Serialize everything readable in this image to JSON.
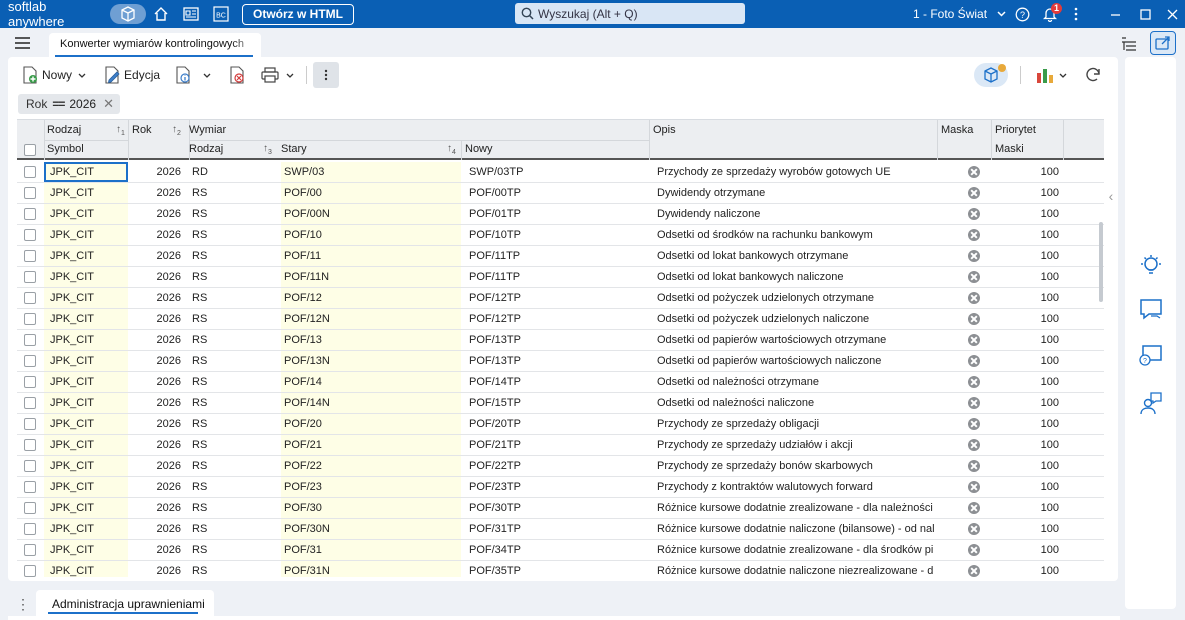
{
  "titlebar": {
    "app_name": "softlab anywhere",
    "open_html_label": "Otwórz w HTML",
    "search_placeholder": "Wyszukaj (Alt + Q)",
    "company": "1 - Foto Świat",
    "notification_count": "1",
    "bc_label": "BC"
  },
  "tabs": {
    "active_doc": "Konwerter wymiarów kontrolingowych"
  },
  "toolbar": {
    "new_label": "Nowy",
    "edit_label": "Edycja"
  },
  "filter": {
    "field": "Rok",
    "operator": "==",
    "value": "2026"
  },
  "grid": {
    "headers": {
      "rodzaj": "Rodzaj",
      "rok": "Rok",
      "wymiar": "Wymiar",
      "opis": "Opis",
      "maska": "Maska",
      "priorytet": "Priorytet",
      "symbol": "Symbol",
      "rodzaj2": "Rodzaj",
      "stary": "Stary",
      "nowy": "Nowy",
      "maski": "Maski",
      "sort1": "1",
      "sort2": "2",
      "sort3": "3",
      "sort4": "4"
    },
    "rows": [
      {
        "symbol": "JPK_CIT",
        "rok": "2026",
        "rodzaj": "RD",
        "stary": "SWP/03",
        "nowy": "SWP/03TP",
        "opis": "Przychody ze sprzedaży wyrobów gotowych UE",
        "priorytet": "100"
      },
      {
        "symbol": "JPK_CIT",
        "rok": "2026",
        "rodzaj": "RS",
        "stary": "POF/00",
        "nowy": "POF/00TP",
        "opis": "Dywidendy otrzymane",
        "priorytet": "100"
      },
      {
        "symbol": "JPK_CIT",
        "rok": "2026",
        "rodzaj": "RS",
        "stary": "POF/00N",
        "nowy": "POF/01TP",
        "opis": "Dywidendy naliczone",
        "priorytet": "100"
      },
      {
        "symbol": "JPK_CIT",
        "rok": "2026",
        "rodzaj": "RS",
        "stary": "POF/10",
        "nowy": "POF/10TP",
        "opis": "Odsetki od środków na rachunku bankowym",
        "priorytet": "100"
      },
      {
        "symbol": "JPK_CIT",
        "rok": "2026",
        "rodzaj": "RS",
        "stary": "POF/11",
        "nowy": "POF/11TP",
        "opis": "Odsetki od lokat bankowych otrzymane",
        "priorytet": "100"
      },
      {
        "symbol": "JPK_CIT",
        "rok": "2026",
        "rodzaj": "RS",
        "stary": "POF/11N",
        "nowy": "POF/11TP",
        "opis": "Odsetki od lokat bankowych naliczone",
        "priorytet": "100"
      },
      {
        "symbol": "JPK_CIT",
        "rok": "2026",
        "rodzaj": "RS",
        "stary": "POF/12",
        "nowy": "POF/12TP",
        "opis": "Odsetki od pożyczek udzielonych otrzymane",
        "priorytet": "100"
      },
      {
        "symbol": "JPK_CIT",
        "rok": "2026",
        "rodzaj": "RS",
        "stary": "POF/12N",
        "nowy": "POF/12TP",
        "opis": "Odsetki od pożyczek udzielonych naliczone",
        "priorytet": "100"
      },
      {
        "symbol": "JPK_CIT",
        "rok": "2026",
        "rodzaj": "RS",
        "stary": "POF/13",
        "nowy": "POF/13TP",
        "opis": "Odsetki od papierów wartościowych otrzymane",
        "priorytet": "100"
      },
      {
        "symbol": "JPK_CIT",
        "rok": "2026",
        "rodzaj": "RS",
        "stary": "POF/13N",
        "nowy": "POF/13TP",
        "opis": "Odsetki od papierów wartościowych naliczone",
        "priorytet": "100"
      },
      {
        "symbol": "JPK_CIT",
        "rok": "2026",
        "rodzaj": "RS",
        "stary": "POF/14",
        "nowy": "POF/14TP",
        "opis": "Odsetki od należności otrzymane",
        "priorytet": "100"
      },
      {
        "symbol": "JPK_CIT",
        "rok": "2026",
        "rodzaj": "RS",
        "stary": "POF/14N",
        "nowy": "POF/15TP",
        "opis": "Odsetki od należności naliczone",
        "priorytet": "100"
      },
      {
        "symbol": "JPK_CIT",
        "rok": "2026",
        "rodzaj": "RS",
        "stary": "POF/20",
        "nowy": "POF/20TP",
        "opis": "Przychody ze sprzedaży obligacji",
        "priorytet": "100"
      },
      {
        "symbol": "JPK_CIT",
        "rok": "2026",
        "rodzaj": "RS",
        "stary": "POF/21",
        "nowy": "POF/21TP",
        "opis": "Przychody ze sprzedaży udziałów i akcji",
        "priorytet": "100"
      },
      {
        "symbol": "JPK_CIT",
        "rok": "2026",
        "rodzaj": "RS",
        "stary": "POF/22",
        "nowy": "POF/22TP",
        "opis": "Przychody ze sprzedaży bonów skarbowych",
        "priorytet": "100"
      },
      {
        "symbol": "JPK_CIT",
        "rok": "2026",
        "rodzaj": "RS",
        "stary": "POF/23",
        "nowy": "POF/23TP",
        "opis": "Przychody z kontraktów walutowych forward",
        "priorytet": "100"
      },
      {
        "symbol": "JPK_CIT",
        "rok": "2026",
        "rodzaj": "RS",
        "stary": "POF/30",
        "nowy": "POF/30TP",
        "opis": "Różnice kursowe dodatnie zrealizowane -  dla należności",
        "priorytet": "100"
      },
      {
        "symbol": "JPK_CIT",
        "rok": "2026",
        "rodzaj": "RS",
        "stary": "POF/30N",
        "nowy": "POF/31TP",
        "opis": "Różnice kursowe dodatnie naliczone (bilansowe) - od nal",
        "priorytet": "100"
      },
      {
        "symbol": "JPK_CIT",
        "rok": "2026",
        "rodzaj": "RS",
        "stary": "POF/31",
        "nowy": "POF/34TP",
        "opis": "Różnice kursowe dodatnie zrealizowane -  dla środków pi",
        "priorytet": "100"
      },
      {
        "symbol": "JPK_CIT",
        "rok": "2026",
        "rodzaj": "RS",
        "stary": "POF/31N",
        "nowy": "POF/35TP",
        "opis": "Różnice kursowe dodatnie naliczone niezrealizowane -  d",
        "priorytet": "100"
      }
    ]
  },
  "bottom": {
    "tab_label": "Administracja uprawnieniami"
  },
  "colors": {
    "brand": "#0a5fb4",
    "accent": "#1c70c9",
    "highlight_column": "#fefee6",
    "badge": "#e23b3b"
  }
}
